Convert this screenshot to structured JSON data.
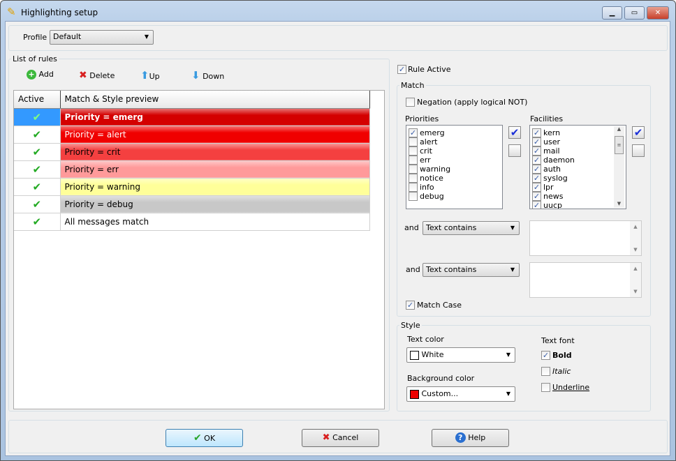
{
  "window": {
    "title": "Highlighting setup",
    "icon": "highlighter-icon"
  },
  "profile": {
    "label": "Profile",
    "value": "Default"
  },
  "rules": {
    "group_label": "List of rules",
    "toolbar": {
      "add": "Add",
      "delete": "Delete",
      "up": "Up",
      "down": "Down"
    },
    "columns": [
      "Active",
      "Match & Style preview"
    ],
    "rows": [
      {
        "active": true,
        "text": "Priority = emerg",
        "bold": true,
        "bg": "#d40000",
        "fg": "#ffffff"
      },
      {
        "active": true,
        "text": "Priority = alert",
        "bold": false,
        "bg": "#f00000",
        "fg": "#ffffff"
      },
      {
        "active": true,
        "text": "Priority = crit",
        "bold": false,
        "bg": "#f44040",
        "fg": "#000000"
      },
      {
        "active": true,
        "text": "Priority = err",
        "bold": false,
        "bg": "#ff9a9a",
        "fg": "#000000"
      },
      {
        "active": true,
        "text": "Priority = warning",
        "bold": false,
        "bg": "#ffff99",
        "fg": "#000000"
      },
      {
        "active": true,
        "text": "Priority = debug",
        "bold": false,
        "bg": "#c8c8c8",
        "fg": "#000000"
      },
      {
        "active": true,
        "text": "All messages match",
        "bold": false,
        "bg": "#ffffff",
        "fg": "#000000"
      }
    ]
  },
  "rule_active": {
    "label": "Rule Active",
    "checked": true
  },
  "match": {
    "group_label": "Match",
    "negation": {
      "label": "Negation (apply logical NOT)",
      "checked": false
    },
    "priorities_label": "Priorities",
    "priorities": [
      {
        "name": "emerg",
        "checked": true
      },
      {
        "name": "alert",
        "checked": false
      },
      {
        "name": "crit",
        "checked": false
      },
      {
        "name": "err",
        "checked": false
      },
      {
        "name": "warning",
        "checked": false
      },
      {
        "name": "notice",
        "checked": false
      },
      {
        "name": "info",
        "checked": false
      },
      {
        "name": "debug",
        "checked": false
      }
    ],
    "facilities_label": "Facilities",
    "facilities": [
      {
        "name": "kern",
        "checked": true
      },
      {
        "name": "user",
        "checked": true
      },
      {
        "name": "mail",
        "checked": true
      },
      {
        "name": "daemon",
        "checked": true
      },
      {
        "name": "auth",
        "checked": true
      },
      {
        "name": "syslog",
        "checked": true
      },
      {
        "name": "lpr",
        "checked": true
      },
      {
        "name": "news",
        "checked": true
      },
      {
        "name": "uucp",
        "checked": true
      }
    ],
    "conditions": [
      {
        "and": "and",
        "type": "Text contains",
        "value": ""
      },
      {
        "and": "and",
        "type": "Text contains",
        "value": ""
      }
    ],
    "match_case": {
      "label": "Match Case",
      "checked": true
    }
  },
  "style": {
    "group_label": "Style",
    "text_color_label": "Text color",
    "text_color": "White",
    "text_color_swatch": "#ffffff",
    "bg_color_label": "Background color",
    "bg_color": "Custom...",
    "bg_color_swatch": "#ee0000",
    "text_font_label": "Text font",
    "bold": {
      "label": "Bold",
      "checked": true
    },
    "italic": {
      "label": "Italic",
      "checked": false
    },
    "underline": {
      "label": "Underline",
      "checked": false
    }
  },
  "buttons": {
    "ok": "OK",
    "cancel": "Cancel",
    "help": "Help"
  }
}
